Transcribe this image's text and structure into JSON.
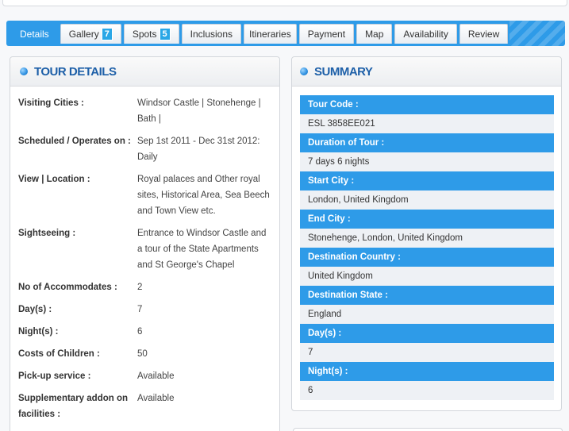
{
  "tabs": [
    {
      "label": "Details",
      "badge": ""
    },
    {
      "label": "Gallery",
      "badge": "7"
    },
    {
      "label": "Spots",
      "badge": "5"
    },
    {
      "label": "Inclusions",
      "badge": ""
    },
    {
      "label": "Itineraries",
      "badge": ""
    },
    {
      "label": "Payment",
      "badge": ""
    },
    {
      "label": "Map",
      "badge": ""
    },
    {
      "label": "Availability",
      "badge": ""
    },
    {
      "label": "Review",
      "badge": ""
    }
  ],
  "tour_details": {
    "title": "TOUR DETAILS",
    "rows": [
      {
        "label": "Visiting Cities :",
        "value": "Windsor Castle | Stonehenge | Bath |"
      },
      {
        "label": "Scheduled / Operates on :",
        "value": "Sep 1st 2011 - Dec 31st 2012: Daily"
      },
      {
        "label": "View | Location :",
        "value": "Royal palaces and Other royal sites, Historical Area, Sea Beech and Town View etc."
      },
      {
        "label": "Sightseeing :",
        "value": "Entrance to Windsor Castle and a tour of the State Apartments and St George's Chapel"
      },
      {
        "label": "No of Accommodates :",
        "value": "2"
      },
      {
        "label": "Day(s) :",
        "value": "7"
      },
      {
        "label": "Night(s) :",
        "value": "6"
      },
      {
        "label": "Costs of Children :",
        "value": "50"
      },
      {
        "label": "Pick-up service :",
        "value": "Available"
      },
      {
        "label": "Supplementary addon on facilities :",
        "value": "Available"
      }
    ]
  },
  "summary": {
    "title": "SUMMARY",
    "items": [
      {
        "label": "Tour Code :",
        "value": "ESL 3858EE021"
      },
      {
        "label": "Duration of Tour :",
        "value": "7 days 6 nights"
      },
      {
        "label": "Start City :",
        "value": "London, United Kingdom"
      },
      {
        "label": "End City :",
        "value": "Stonehenge, London, United Kingdom"
      },
      {
        "label": "Destination Country :",
        "value": "United Kingdom"
      },
      {
        "label": "Destination State :",
        "value": "England"
      },
      {
        "label": "Day(s) :",
        "value": "7"
      },
      {
        "label": "Night(s) :",
        "value": "6"
      }
    ]
  },
  "colors": {
    "accent": "#2e9be8",
    "title": "#1d5fa8"
  },
  "icons": {
    "panel_bullet": "bullet-dot-icon"
  }
}
